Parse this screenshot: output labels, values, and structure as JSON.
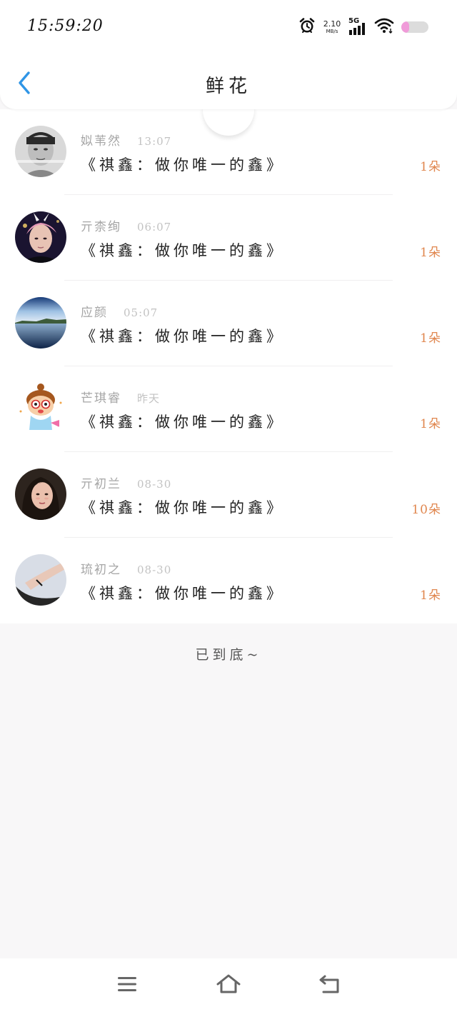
{
  "status_bar": {
    "time": "15:59:20",
    "net_speed": "2.10",
    "net_unit": "MB/s",
    "network": "5G",
    "icons": [
      "alarm-icon",
      "signal-icon",
      "wifi-icon",
      "battery-icon"
    ],
    "battery_level": 0.3
  },
  "nav": {
    "title": "鲜花",
    "back_icon": "chevron-left-icon"
  },
  "list": {
    "items": [
      {
        "name": "姒苇然",
        "time": "13:07",
        "book": "《祺鑫：做你唯一的鑫》",
        "count": "1朵"
      },
      {
        "name": "亓柰绚",
        "time": "06:07",
        "book": "《祺鑫：做你唯一的鑫》",
        "count": "1朵"
      },
      {
        "name": "应颜",
        "time": "05:07",
        "book": "《祺鑫：做你唯一的鑫》",
        "count": "1朵"
      },
      {
        "name": "芒琪睿",
        "time": "昨天",
        "book": "《祺鑫：做你唯一的鑫》",
        "count": "1朵"
      },
      {
        "name": "亓初兰",
        "time": "08-30",
        "book": "《祺鑫：做你唯一的鑫》",
        "count": "10朵"
      },
      {
        "name": "琉初之",
        "time": "08-30",
        "book": "《祺鑫：做你唯一的鑫》",
        "count": "1朵"
      }
    ]
  },
  "end_text": "已到底~",
  "bottom_nav": {
    "icons": [
      "menu-icon",
      "home-icon",
      "back-arrow-icon"
    ]
  },
  "colors": {
    "accent_blue": "#2f95e6",
    "count_orange": "#e0864e",
    "background": "#f8f7f8"
  }
}
